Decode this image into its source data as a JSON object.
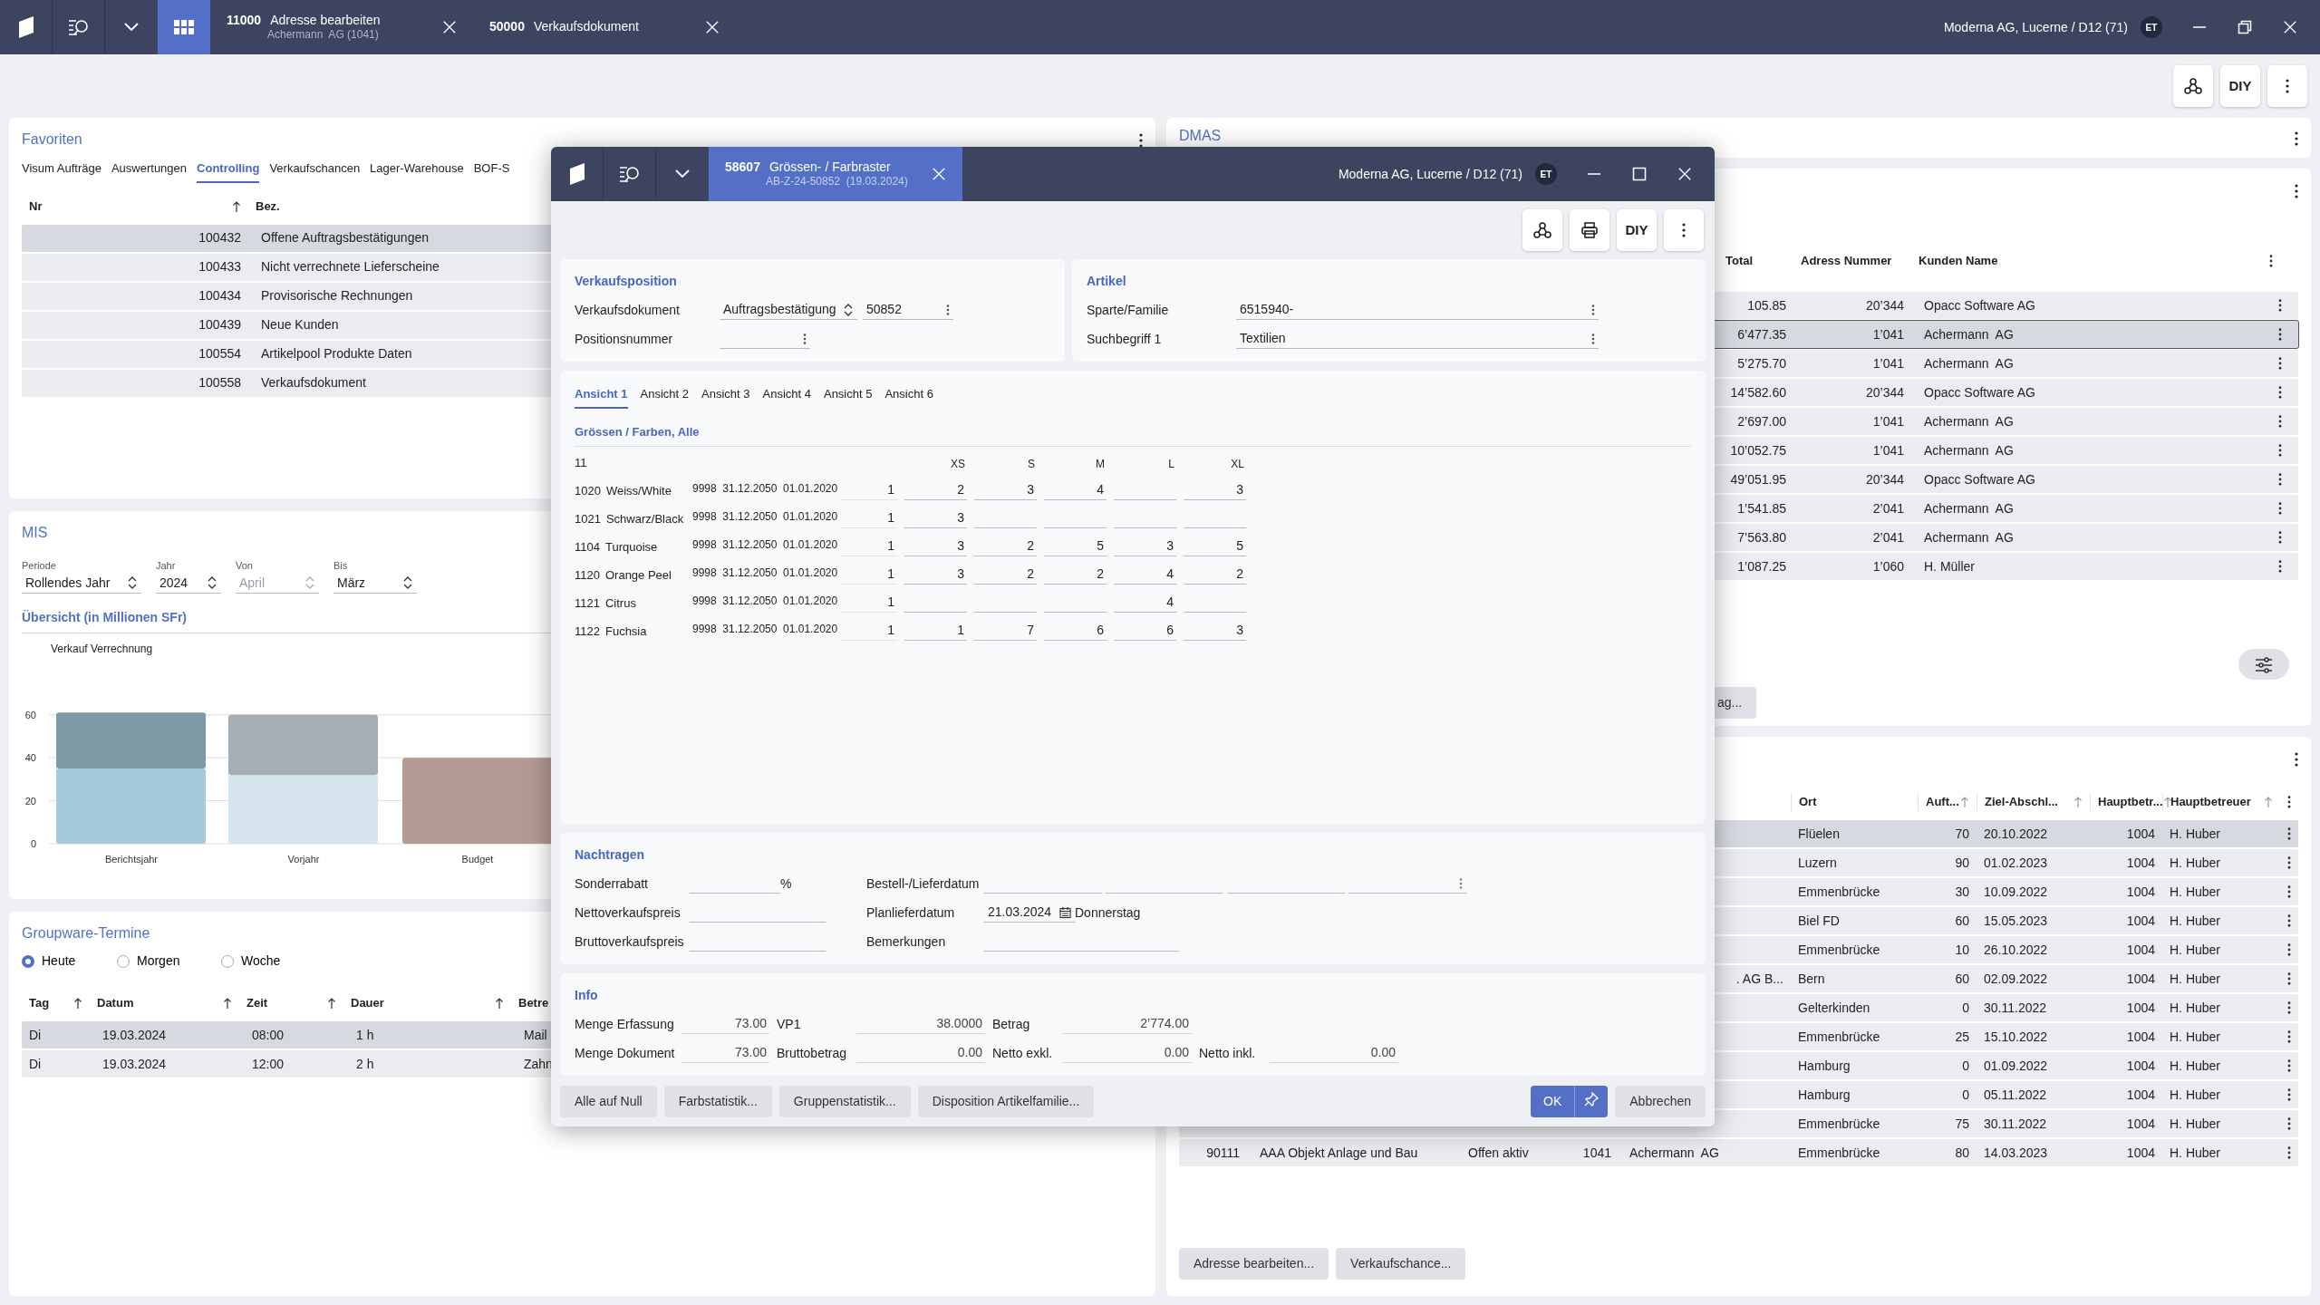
{
  "app_bar": {
    "tabs": [
      {
        "number": "11000",
        "title": "Adresse bearbeiten",
        "subtitle": "Achermann  AG (1041)"
      },
      {
        "number": "50000",
        "title": "Verkaufsdokument"
      }
    ],
    "company": "Moderna AG, Lucerne / D12 (71)",
    "user": "ET"
  },
  "toolbar": {
    "diy": "DIY"
  },
  "favoriten": {
    "title": "Favoriten",
    "tabs": [
      {
        "label": "Visum Aufträge",
        "selected": false
      },
      {
        "label": "Auswertungen",
        "selected": false
      },
      {
        "label": "Controlling",
        "selected": true
      },
      {
        "label": "Verkaufschancen",
        "selected": false
      },
      {
        "label": "Lager-Warehouse",
        "selected": false
      },
      {
        "label": "BOF-S",
        "selected": false
      }
    ],
    "columns": [
      "Nr",
      "Bez."
    ],
    "rows": [
      {
        "nr": "100432",
        "bez": "Offene Auftragsbestätigungen",
        "selected": true
      },
      {
        "nr": "100433",
        "bez": "Nicht verrechnete Lieferscheine",
        "selected": false
      },
      {
        "nr": "100434",
        "bez": "Provisorische Rechnungen",
        "selected": false
      },
      {
        "nr": "100439",
        "bez": "Neue Kunden",
        "selected": false
      },
      {
        "nr": "100554",
        "bez": "Artikelpool Produkte Daten",
        "selected": false
      },
      {
        "nr": "100558",
        "bez": "Verkaufsdokument",
        "selected": false
      }
    ]
  },
  "mis": {
    "title": "MIS",
    "filters": [
      {
        "label": "Periode",
        "value": "Rollendes Jahr",
        "disabled": false
      },
      {
        "label": "Jahr",
        "value": "2024",
        "disabled": false
      },
      {
        "label": "Von",
        "value": "April",
        "disabled": true
      },
      {
        "label": "Bis",
        "value": "März",
        "disabled": false
      }
    ],
    "overview_title": "Übersicht (in Millionen SFr)",
    "chart_data": {
      "type": "bar",
      "title": "Verkauf Verrechnung",
      "categories": [
        "Berichtsjahr",
        "Vorjahr",
        "Budget"
      ],
      "stacked": true,
      "grid": true,
      "ylim": [
        0,
        62
      ],
      "yticks": [
        0,
        20,
        40,
        60
      ],
      "series": [
        {
          "color": "#a6c9dc",
          "values": [
            35,
            null,
            null
          ]
        },
        {
          "color": "#8099a6",
          "values": [
            26,
            null,
            null
          ]
        },
        {
          "color": "#d6e5ed",
          "values": [
            null,
            32,
            null
          ]
        },
        {
          "color": "#a4aeb4",
          "values": [
            null,
            28,
            null
          ]
        },
        {
          "color": "#b39b94",
          "values": [
            null,
            null,
            40
          ]
        }
      ]
    }
  },
  "groupware": {
    "title": "Groupware-Termine",
    "options": [
      {
        "label": "Heute",
        "selected": true
      },
      {
        "label": "Morgen",
        "selected": false
      },
      {
        "label": "Woche",
        "selected": false
      }
    ],
    "columns": [
      "Tag",
      "Datum",
      "Zeit",
      "Dauer",
      "Betre"
    ],
    "rows": [
      {
        "cells": [
          "Di",
          "19.03.2024",
          "08:00",
          "1 h",
          "Mail"
        ],
        "selected": true
      },
      {
        "cells": [
          "Di",
          "19.03.2024",
          "12:00",
          "2 h",
          "Zahn"
        ],
        "selected": false
      }
    ]
  },
  "dmas": {
    "title": "DMAS"
  },
  "orders": {
    "columns": [
      "Total",
      "Adress Nummer",
      "Kunden Name"
    ],
    "rows": [
      {
        "cells": [
          "105.85",
          "20’344",
          "Opacc Software AG"
        ],
        "selected": false
      },
      {
        "cells": [
          "6’477.35",
          "1’041",
          "Achermann  AG"
        ],
        "selected": true
      },
      {
        "cells": [
          "5’275.70",
          "1’041",
          "Achermann  AG"
        ],
        "selected": false
      },
      {
        "cells": [
          "14’582.60",
          "20’344",
          "Opacc Software AG"
        ],
        "selected": false
      },
      {
        "cells": [
          "2’697.00",
          "1’041",
          "Achermann  AG"
        ],
        "selected": false
      },
      {
        "cells": [
          "10’052.75",
          "1’041",
          "Achermann  AG"
        ],
        "selected": false
      },
      {
        "cells": [
          "49’051.95",
          "20’344",
          "Opacc Software AG"
        ],
        "selected": false
      },
      {
        "cells": [
          "1’541.85",
          "2’041",
          "Achermann  AG"
        ],
        "selected": false
      },
      {
        "cells": [
          "7’563.80",
          "2’041",
          "Achermann  AG"
        ],
        "selected": false
      },
      {
        "cells": [
          "1’087.25",
          "1’060",
          "H. Müller"
        ],
        "selected": false
      }
    ],
    "button": "ag..."
  },
  "opportunities": {
    "columns": [
      "Ort",
      "Auft...",
      "Ziel-Abschl...",
      "Hauptbetr...",
      "Hauptbetreuer"
    ],
    "rows": [
      {
        "cells": [
          "Flüelen",
          "70",
          "20.10.2022",
          "1004",
          "H. Huber"
        ],
        "selected": true
      },
      {
        "cells": [
          "Luzern",
          "90",
          "01.02.2023",
          "1004",
          "H. Huber"
        ],
        "selected": false
      },
      {
        "cells": [
          "Emmenbrücke",
          "30",
          "10.09.2022",
          "1004",
          "H. Huber"
        ],
        "selected": false
      },
      {
        "cells": [
          "Biel FD",
          "60",
          "15.05.2023",
          "1004",
          "H. Huber"
        ],
        "selected": false
      },
      {
        "cells": [
          "Emmenbrücke",
          "10",
          "26.10.2022",
          "1004",
          "H. Huber"
        ],
        "selected": false
      },
      {
        "kunde": ". AG B...",
        "cells": [
          "Bern",
          "60",
          "02.09.2022",
          "1004",
          "H. Huber"
        ],
        "selected": false
      },
      {
        "cells": [
          "Gelterkinden",
          "0",
          "30.11.2022",
          "1004",
          "H. Huber"
        ],
        "selected": false
      },
      {
        "cells": [
          "Emmenbrücke",
          "25",
          "15.10.2022",
          "1004",
          "H. Huber"
        ],
        "selected": false
      },
      {
        "cells": [
          "Hamburg",
          "0",
          "01.09.2022",
          "1004",
          "H. Huber"
        ],
        "selected": false
      },
      {
        "cells": [
          "Hamburg",
          "0",
          "05.11.2022",
          "1004",
          "H. Huber"
        ],
        "selected": false
      },
      {
        "cells": [
          "Emmenbrücke",
          "75",
          "30.11.2022",
          "1004",
          "H. Huber"
        ],
        "selected": false
      },
      {
        "lead": [
          "90111",
          "AAA Objekt Anlage und Bau",
          "Offen aktiv",
          "1041"
        ],
        "kunde": "Achermann  AG",
        "cells": [
          "Emmenbrücke",
          "80",
          "14.03.2023",
          "1004",
          "H. Huber"
        ],
        "selected": false
      }
    ],
    "buttons": [
      "Adresse bearbeiten...",
      "Verkaufschance..."
    ]
  },
  "dialog": {
    "tab": {
      "number": "58607",
      "title": "Grössen- / Farbraster",
      "subtitle": "AB-Z-24-50852  (19.03.2024)"
    },
    "company": "Moderna AG, Lucerne / D12 (71)",
    "user": "ET",
    "diy": "DIY",
    "verkaufsposition": {
      "title": "Verkaufsposition",
      "dokument_label": "Verkaufsdokument",
      "dokument_type": "Auftragsbestätigung",
      "dokument_nr": "50852",
      "position_label": "Positionsnummer"
    },
    "artikel": {
      "title": "Artikel",
      "fields": [
        {
          "label": "Sparte/Familie",
          "value": "6515940-"
        },
        {
          "label": "Suchbegriff 1",
          "value": "Textilien"
        }
      ]
    },
    "views": [
      {
        "label": "Ansicht 1",
        "selected": true
      },
      {
        "label": "Ansicht 2",
        "selected": false
      },
      {
        "label": "Ansicht 3",
        "selected": false
      },
      {
        "label": "Ansicht 4",
        "selected": false
      },
      {
        "label": "Ansicht 5",
        "selected": false
      },
      {
        "label": "Ansicht 6",
        "selected": false
      }
    ],
    "grid": {
      "title": "Grössen / Farben, Alle",
      "corner": "11",
      "sizes": [
        "XS",
        "S",
        "M",
        "L",
        "XL"
      ],
      "rows": [
        {
          "code": "1020",
          "name": "Weiss/White",
          "meta": "9998  31.12.2050  01.01.2020",
          "qty": "1",
          "values": [
            {
              "kind": "qty",
              "value": "2"
            },
            {
              "kind": "qty",
              "value": "3"
            },
            {
              "kind": "qty",
              "value": "4"
            },
            {
              "kind": "blank"
            },
            {
              "kind": "qty",
              "value": "3"
            }
          ]
        },
        {
          "code": "1021",
          "name": "Schwarz/Black",
          "meta": "9998  31.12.2050  01.01.2020",
          "qty": "1",
          "values": [
            {
              "kind": "qty",
              "value": "3"
            },
            {
              "kind": "blank"
            },
            {
              "kind": "blank"
            },
            {
              "kind": "blank"
            },
            {
              "kind": "blank"
            }
          ]
        },
        {
          "code": "1104",
          "name": "Turquoise",
          "meta": "9998  31.12.2050  01.01.2020",
          "qty": "1",
          "values": [
            {
              "kind": "qty",
              "value": "3"
            },
            {
              "kind": "qty",
              "value": "2"
            },
            {
              "kind": "qty",
              "value": "5"
            },
            {
              "kind": "qty",
              "value": "3"
            },
            {
              "kind": "qty",
              "value": "5"
            }
          ]
        },
        {
          "code": "1120",
          "name": "Orange Peel",
          "meta": "9998  31.12.2050  01.01.2020",
          "qty": "1",
          "values": [
            {
              "kind": "qty",
              "value": "3"
            },
            {
              "kind": "qty",
              "value": "2"
            },
            {
              "kind": "qty",
              "value": "2"
            },
            {
              "kind": "qty",
              "value": "4"
            },
            {
              "kind": "qty",
              "value": "2"
            }
          ]
        },
        {
          "code": "1121",
          "name": "Citrus",
          "meta": "9998  31.12.2050  01.01.2020",
          "qty": "1",
          "values": [
            {
              "kind": "blank"
            },
            {
              "kind": "blank"
            },
            {
              "kind": "blank"
            },
            {
              "kind": "qty",
              "value": "4"
            },
            {
              "kind": "blank"
            }
          ]
        },
        {
          "code": "1122",
          "name": "Fuchsia",
          "meta": "9998  31.12.2050  01.01.2020",
          "qty": "1",
          "values": [
            {
              "kind": "qty",
              "value": "1"
            },
            {
              "kind": "qty",
              "value": "7"
            },
            {
              "kind": "qty",
              "value": "6"
            },
            {
              "kind": "qty",
              "value": "6"
            },
            {
              "kind": "qty",
              "value": "3"
            }
          ]
        }
      ]
    },
    "nachtragen": {
      "title": "Nachtragen",
      "sonderrabatt": "Sonderrabatt",
      "percent": "%",
      "bestell": "Bestell-/Lieferdatum",
      "netto": "Nettoverkaufspreis",
      "plan": "Planlieferdatum",
      "plan_date": "21.03.2024",
      "plan_day": "Donnerstag",
      "brutto": "Bruttoverkaufspreis",
      "bemerkungen": "Bemerkungen"
    },
    "info": {
      "title": "Info",
      "rows": [
        [
          {
            "label": "Menge Erfassung",
            "value": "73.00"
          },
          {
            "label": "VP1",
            "value": "38.0000"
          },
          {
            "label": "Betrag",
            "value": "2’774.00"
          }
        ],
        [
          {
            "label": "Menge Dokument",
            "value": "73.00"
          },
          {
            "label": "Bruttobetrag",
            "value": "0.00"
          },
          {
            "label": "Netto exkl.",
            "value": "0.00"
          },
          {
            "label": "Netto inkl.",
            "value": "0.00"
          }
        ]
      ]
    },
    "buttons": [
      "Alle auf Null",
      "Farbstatistik...",
      "Gruppenstatistik...",
      "Disposition Artikelfamilie..."
    ],
    "ok": "OK",
    "cancel": "Abbrechen"
  }
}
